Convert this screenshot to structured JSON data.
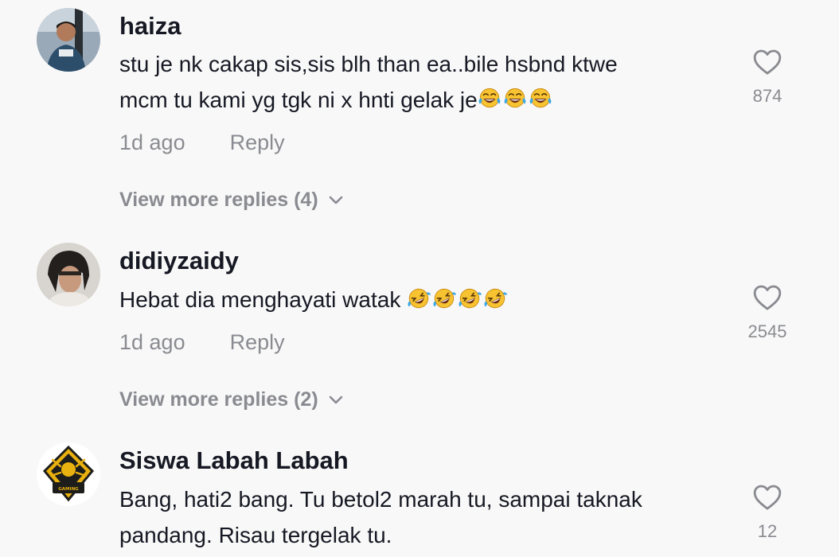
{
  "comments": [
    {
      "username": "haiza",
      "text_line1": "stu je nk cakap sis,sis blh than ea..bile hsbnd ktwe",
      "text_line2": "mcm tu kami yg tgk ni x hnti gelak je",
      "emojis": [
        "tears-of-joy-emoji",
        "tears-of-joy-emoji",
        "tears-of-joy-emoji"
      ],
      "time": "1d ago",
      "reply": "Reply",
      "like_count": "874",
      "view_more": "View more replies (4)"
    },
    {
      "username": "didiyzaidy",
      "text_line1": "Hebat dia menghayati watak ",
      "emojis": [
        "rofl-emoji",
        "rofl-emoji",
        "rofl-emoji",
        "rofl-emoji"
      ],
      "time": "1d ago",
      "reply": "Reply",
      "like_count": "2545",
      "view_more": "View more replies (2)"
    },
    {
      "username": "Siswa Labah Labah",
      "text_line1": "Bang, hati2 bang. Tu betol2 marah tu, sampai taknak",
      "text_line2": "pandang. Risau tergelak tu.",
      "like_count": "12",
      "avatar_logo_text": "LABAH-LABAH GAMING"
    }
  ],
  "colors": {
    "background": "#f8f8f8",
    "primary_text": "#161823",
    "secondary_text": "#8a8b91"
  }
}
